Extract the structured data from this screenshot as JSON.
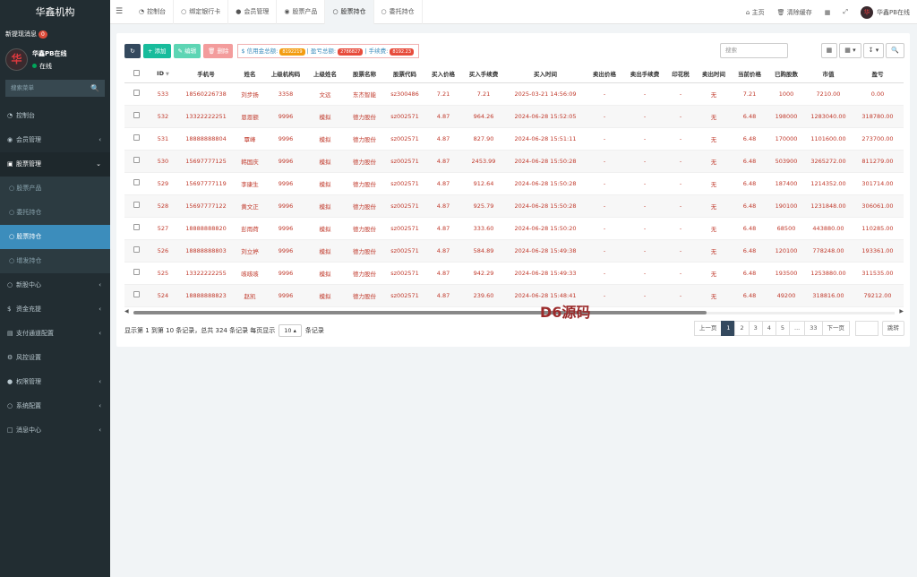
{
  "sidebar": {
    "brand": "华鑫机构",
    "notice": "新提现消息",
    "notice_count": "0",
    "user_name": "华鑫PB在线",
    "user_status": "在线",
    "search_placeholder": "搜索菜单",
    "items": [
      {
        "label": "控制台",
        "icon": "dashboard-icon"
      },
      {
        "label": "会员管理",
        "icon": "user-circle-icon"
      },
      {
        "label": "股票管理",
        "icon": "bank-icon"
      },
      {
        "label": "新股中心",
        "icon": "circle-icon"
      },
      {
        "label": "资金充提",
        "icon": "dollar-icon"
      },
      {
        "label": "支付通道配置",
        "icon": "cart-icon"
      },
      {
        "label": "风控设置",
        "icon": "gear-icon"
      },
      {
        "label": "权限管理",
        "icon": "group-icon"
      },
      {
        "label": "系统配置",
        "icon": "circle-icon"
      },
      {
        "label": "消息中心",
        "icon": "inbox-icon"
      }
    ],
    "sub_items": [
      "股票产品",
      "委托持仓",
      "股票持仓",
      "增发持仓"
    ]
  },
  "topbar": {
    "tabs": [
      "控制台",
      "绑定银行卡",
      "会员管理",
      "股票产品",
      "股票持仓",
      "委托持仓"
    ],
    "home": "主页",
    "clear_cache": "清除缓存",
    "user": "华鑫PB在线"
  },
  "toolbar": {
    "add": "添加",
    "edit": "编辑",
    "delete": "删除",
    "credit_label": "信用金总额:",
    "credit_value": "8192219",
    "profit_label": "盈亏总额:",
    "profit_value": "2786827",
    "fee_label": "手续费:",
    "fee_value": "8192.23",
    "search_placeholder": "搜索"
  },
  "table": {
    "headers": [
      "ID",
      "手机号",
      "姓名",
      "上级机构码",
      "上级姓名",
      "股票名称",
      "股票代码",
      "买入价格",
      "买入手续费",
      "买入时间",
      "卖出价格",
      "卖出手续费",
      "印花税",
      "卖出时间",
      "当前价格",
      "已购股数",
      "市值",
      "盈亏"
    ],
    "rows": [
      [
        "533",
        "18560226738",
        "刘步扬",
        "3358",
        "文远",
        "东杰智能",
        "sz300486",
        "7.21",
        "7.21",
        "2025-03-21 14:56:09",
        "-",
        "-",
        "-",
        "无",
        "7.21",
        "1000",
        "7210.00",
        "0.00"
      ],
      [
        "532",
        "13322222251",
        "恩恩额",
        "9996",
        "模拟",
        "德力股份",
        "sz002571",
        "4.87",
        "964.26",
        "2024-06-28 15:52:05",
        "-",
        "-",
        "-",
        "无",
        "6.48",
        "198000",
        "1283040.00",
        "318780.00"
      ],
      [
        "531",
        "18888888804",
        "覃峰",
        "9996",
        "模拟",
        "德力股份",
        "sz002571",
        "4.87",
        "827.90",
        "2024-06-28 15:51:11",
        "-",
        "-",
        "-",
        "无",
        "6.48",
        "170000",
        "1101600.00",
        "273700.00"
      ],
      [
        "530",
        "15697777125",
        "韩国庆",
        "9996",
        "模拟",
        "德力股份",
        "sz002571",
        "4.87",
        "2453.99",
        "2024-06-28 15:50:28",
        "-",
        "-",
        "-",
        "无",
        "6.48",
        "503900",
        "3265272.00",
        "811279.00"
      ],
      [
        "529",
        "15697777119",
        "李康生",
        "9996",
        "模拟",
        "德力股份",
        "sz002571",
        "4.87",
        "912.64",
        "2024-06-28 15:50:28",
        "-",
        "-",
        "-",
        "无",
        "6.48",
        "187400",
        "1214352.00",
        "301714.00"
      ],
      [
        "528",
        "15697777122",
        "黄文正",
        "9996",
        "模拟",
        "德力股份",
        "sz002571",
        "4.87",
        "925.79",
        "2024-06-28 15:50:28",
        "-",
        "-",
        "-",
        "无",
        "6.48",
        "190100",
        "1231848.00",
        "306061.00"
      ],
      [
        "527",
        "18888888820",
        "彭雨荷",
        "9996",
        "模拟",
        "德力股份",
        "sz002571",
        "4.87",
        "333.60",
        "2024-06-28 15:50:20",
        "-",
        "-",
        "-",
        "无",
        "6.48",
        "68500",
        "443880.00",
        "110285.00"
      ],
      [
        "526",
        "18888888803",
        "刘立婷",
        "9996",
        "模拟",
        "德力股份",
        "sz002571",
        "4.87",
        "584.89",
        "2024-06-28 15:49:38",
        "-",
        "-",
        "-",
        "无",
        "6.48",
        "120100",
        "778248.00",
        "193361.00"
      ],
      [
        "525",
        "13322222255",
        "咳咳咳",
        "9996",
        "模拟",
        "德力股份",
        "sz002571",
        "4.87",
        "942.29",
        "2024-06-28 15:49:33",
        "-",
        "-",
        "-",
        "无",
        "6.48",
        "193500",
        "1253880.00",
        "311535.00"
      ],
      [
        "524",
        "18888888823",
        "赵凯",
        "9996",
        "模拟",
        "德力股份",
        "sz002571",
        "4.87",
        "239.60",
        "2024-06-28 15:48:41",
        "-",
        "-",
        "-",
        "无",
        "6.48",
        "49200",
        "318816.00",
        "79212.00"
      ]
    ]
  },
  "footer": {
    "info_prefix": "显示第 1 到第 10 条记录，总共 324 条记录 每页显示",
    "page_size": "10",
    "info_suffix": "条记录",
    "prev": "上一页",
    "next": "下一页",
    "pages": [
      "1",
      "2",
      "3",
      "4",
      "5",
      "...",
      "33"
    ],
    "jump": "跳转"
  },
  "watermark": "D6源码"
}
